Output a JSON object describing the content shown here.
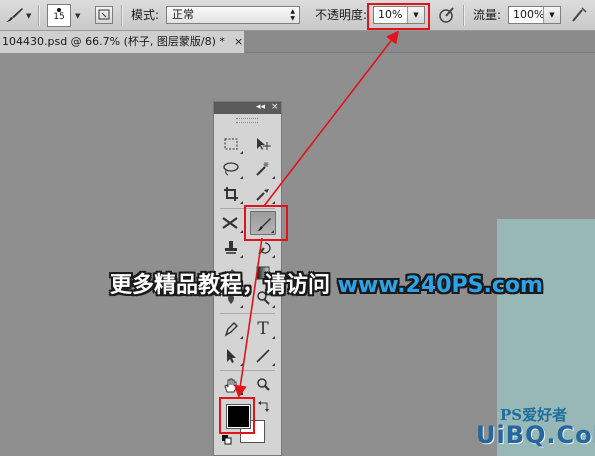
{
  "options_bar": {
    "brush_size": "15",
    "mode_label": "模式:",
    "mode_value": "正常",
    "opacity_label": "不透明度:",
    "opacity_value": "10%",
    "flow_label": "流量:",
    "flow_value": "100%",
    "opacity_value_last": "100%"
  },
  "document_tab": {
    "title": "104430.psd @ 66.7% (杯子, 图层蒙版/8) *",
    "close": "×"
  },
  "tools_panel": {
    "collapse": "◂◂",
    "close": "×",
    "type_tool_glyph": "T"
  },
  "colors": {
    "foreground": "#000000",
    "background": "#ffffff",
    "highlight": "#e0141b",
    "canvas": "#98b7b7"
  },
  "overlay": {
    "text": "更多精品教程，请访问 ",
    "url": "www.240PS.com"
  },
  "watermark": {
    "top": "PS爱好者",
    "main": "UiBQ.CoM"
  }
}
